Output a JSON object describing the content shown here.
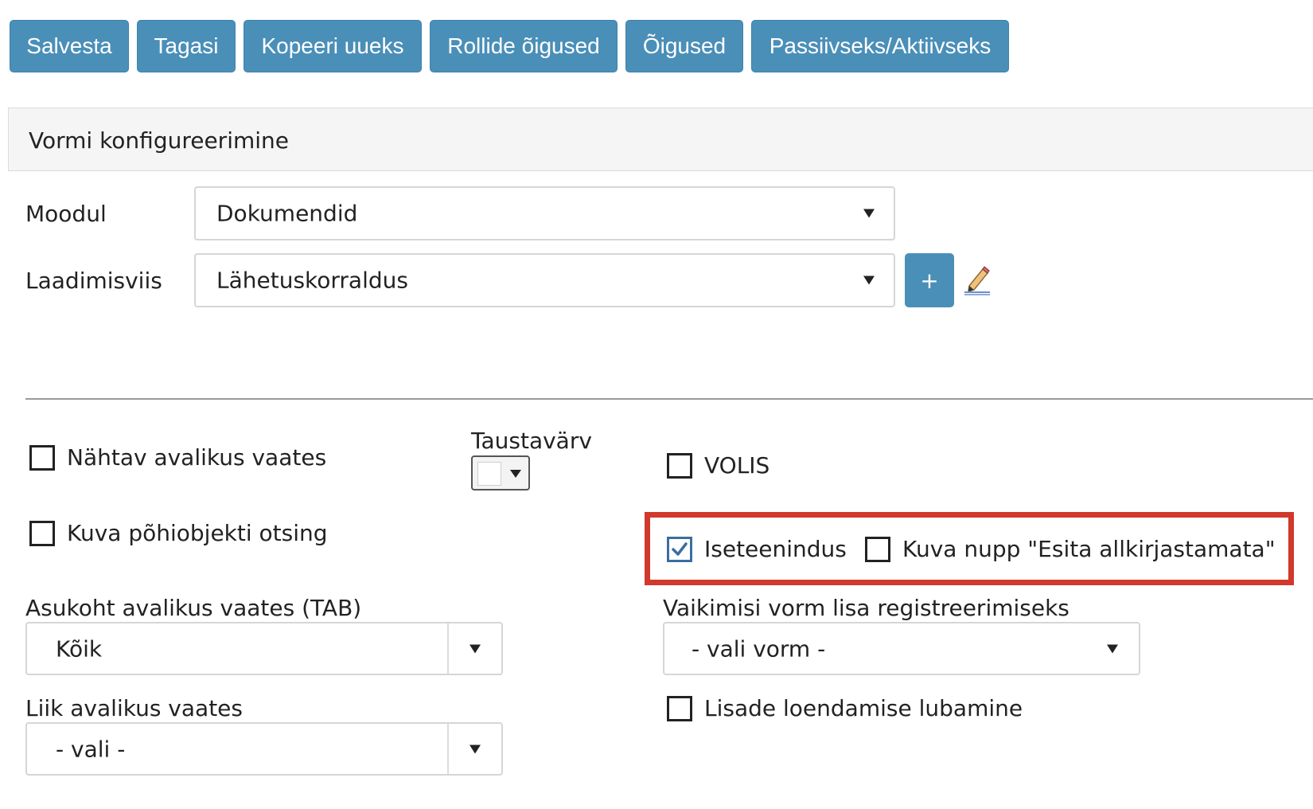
{
  "toolbar": {
    "save": "Salvesta",
    "back": "Tagasi",
    "copy_new": "Kopeeri uueks",
    "role_rights": "Rollide õigused",
    "rights": "Õigused",
    "toggle_active": "Passiivseks/Aktiivseks"
  },
  "section": {
    "title": "Vormi konfigureerimine"
  },
  "fields": {
    "module": {
      "label": "Moodul",
      "value": "Dokumendid"
    },
    "method": {
      "label": "Laadimisviis",
      "value": "Lähetuskorraldus",
      "add_label": "+"
    }
  },
  "options": {
    "visible_public": {
      "label": "Nähtav avalikus vaates",
      "checked": false
    },
    "show_main_search": {
      "label": "Kuva põhiobjekti otsing",
      "checked": false
    },
    "background_color": {
      "label": "Taustavärv",
      "value": "#ffffff"
    },
    "volis": {
      "label": "VOLIS",
      "checked": false
    },
    "self_service": {
      "label": "Iseteenindus",
      "checked": true
    },
    "show_unsigned_button": {
      "label": "Kuva nupp \"Esita allkirjastamata\"",
      "checked": false
    },
    "allow_attachment_count": {
      "label": "Lisade loendamise lubamine",
      "checked": false
    }
  },
  "public_location": {
    "label": "Asukoht avalikus vaates (TAB)",
    "value": "Kõik"
  },
  "public_type": {
    "label": "Liik avalikus vaates",
    "value": "- vali -"
  },
  "default_form": {
    "label": "Vaikimisi vorm lisa registreerimiseks",
    "value": "- vali vorm -"
  },
  "colors": {
    "button": "#4a8fb8",
    "highlight": "#d0392b",
    "check": "#3b6ea0"
  },
  "icons": {
    "edit": "pencil-edit-icon"
  }
}
